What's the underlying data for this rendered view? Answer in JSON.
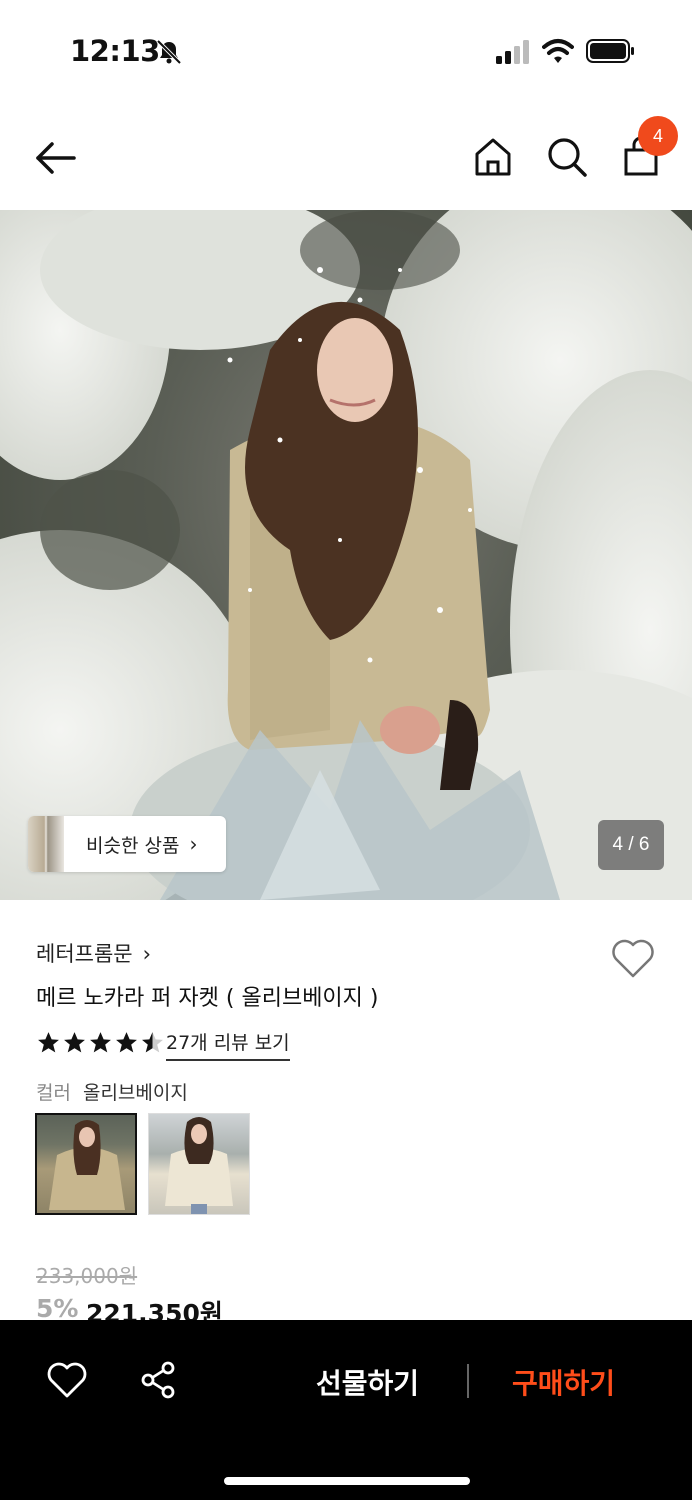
{
  "status": {
    "time": "12:13"
  },
  "nav": {
    "cart_count": "4"
  },
  "hero": {
    "similar_label": "비슷한 상품",
    "pager": "4 / 6"
  },
  "product": {
    "brand": "레터프롬문",
    "title": "메르 노카라 퍼 자켓 ( 올리브베이지 )",
    "rating": 4.5,
    "review_link": "27개 리뷰 보기",
    "color_key": "컬러",
    "color_value": "올리브베이지",
    "original_price": "233,000원",
    "discount": "5%",
    "final_price": "221,350원"
  },
  "bottom": {
    "gift_label": "선물하기",
    "buy_label": "구매하기"
  },
  "colors": {
    "accent": "#f04a1c",
    "buy": "#ff4d1a"
  }
}
